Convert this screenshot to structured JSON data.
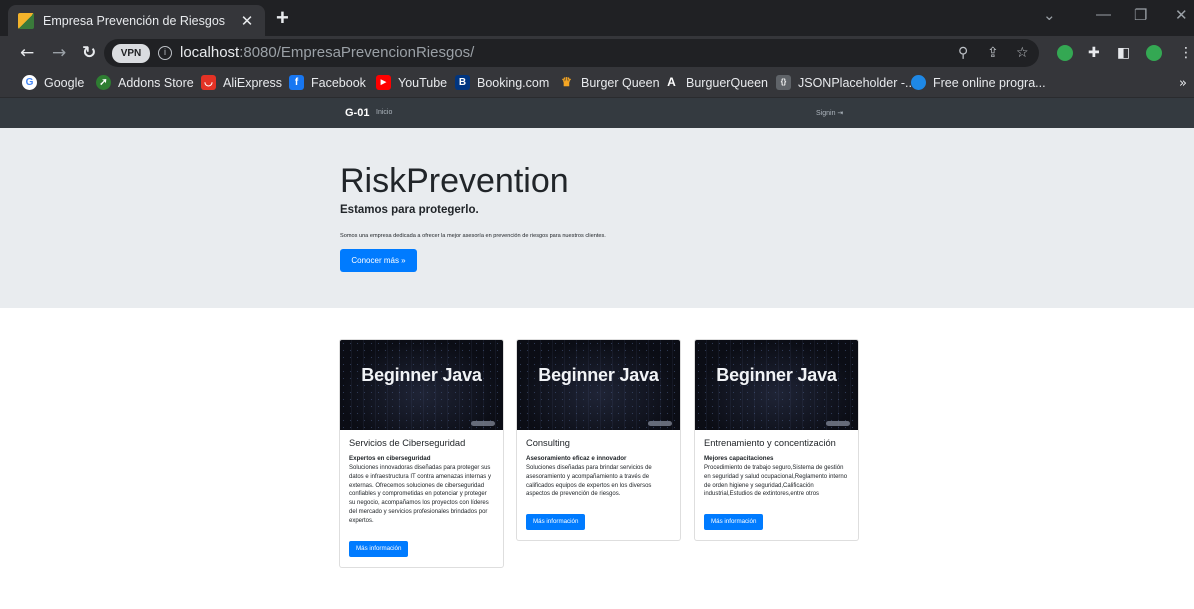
{
  "browser": {
    "tab_title": "Empresa Prevención de Riesgos",
    "tab_close": "✕",
    "new_tab": "+",
    "vpn_badge": "VPN",
    "url_host": "localhost",
    "url_rest": ":8080/EmpresaPrevencionRiesgos/",
    "bookmarks": [
      {
        "label": "Google",
        "icon": "google-icon",
        "color": "#ffffff"
      },
      {
        "label": "Addons Store",
        "icon": "addons-store-icon",
        "color": "#2e7d32"
      },
      {
        "label": "AliExpress",
        "icon": "aliexpress-icon",
        "color": "#e43225"
      },
      {
        "label": "Facebook",
        "icon": "facebook-icon",
        "color": "#1877f2"
      },
      {
        "label": "YouTube",
        "icon": "youtube-icon",
        "color": "#ff0000"
      },
      {
        "label": "Booking.com",
        "icon": "booking-icon",
        "color": "#003580"
      },
      {
        "label": "Burger Queen",
        "icon": "burger-icon",
        "color": "#f5a623"
      },
      {
        "label": "BurguerQueen",
        "icon": "angular-icon",
        "color": "#202124"
      },
      {
        "label": "JSONPlaceholder -...",
        "icon": "jsonplaceholder-icon",
        "color": "#5f6368"
      },
      {
        "label": "Free online progra...",
        "icon": "globe-icon",
        "color": "#1e88e5"
      }
    ],
    "bookmarks_more": "»"
  },
  "navbar": {
    "brand": "G-01",
    "inicio": "Inicio",
    "signin": "Signin"
  },
  "jumbotron": {
    "title": "RiskPrevention",
    "subtitle": "Estamos para protegerlo.",
    "text": "Somos una empresa dedicada a ofrecer la mejor asesoría en prevención de riesgos para nuestros clientes.",
    "button": "Conocer más »"
  },
  "cards": [
    {
      "image_text": "Beginner Java",
      "title": "Servicios de Ciberseguridad",
      "subtitle": "Expertos en ciberseguridad",
      "text": "Soluciones innovadoras diseñadas para proteger sus datos e infraestructura IT contra amenazas internas y externas. Ofrecemos soluciones de ciberseguridad confiables y comprometidas en potenciar y proteger su negocio, acompañamos los proyectos con líderes del mercado y servicios profesionales brindados por expertos.",
      "button": "Más información"
    },
    {
      "image_text": "Beginner Java",
      "title": "Consulting",
      "subtitle": "Asesoramiento eficaz e innovador",
      "text": "Soluciones diseñadas para brindar servicios de asesoramiento y acompañamiento a través de calificados equipos de expertos en los diversos aspectos de prevención de riesgos.",
      "button": "Más información"
    },
    {
      "image_text": "Beginner Java",
      "title": "Entrenamiento y concentización",
      "subtitle": "Mejores capacitaciones",
      "text": "Procedimiento de trabajo seguro,Sistema de gestión en seguridad y salud ocupacional,Reglamento interno de orden higiene y seguridad,Calificación industrial,Estudios de extintores,entre otros",
      "button": "Más información"
    }
  ]
}
